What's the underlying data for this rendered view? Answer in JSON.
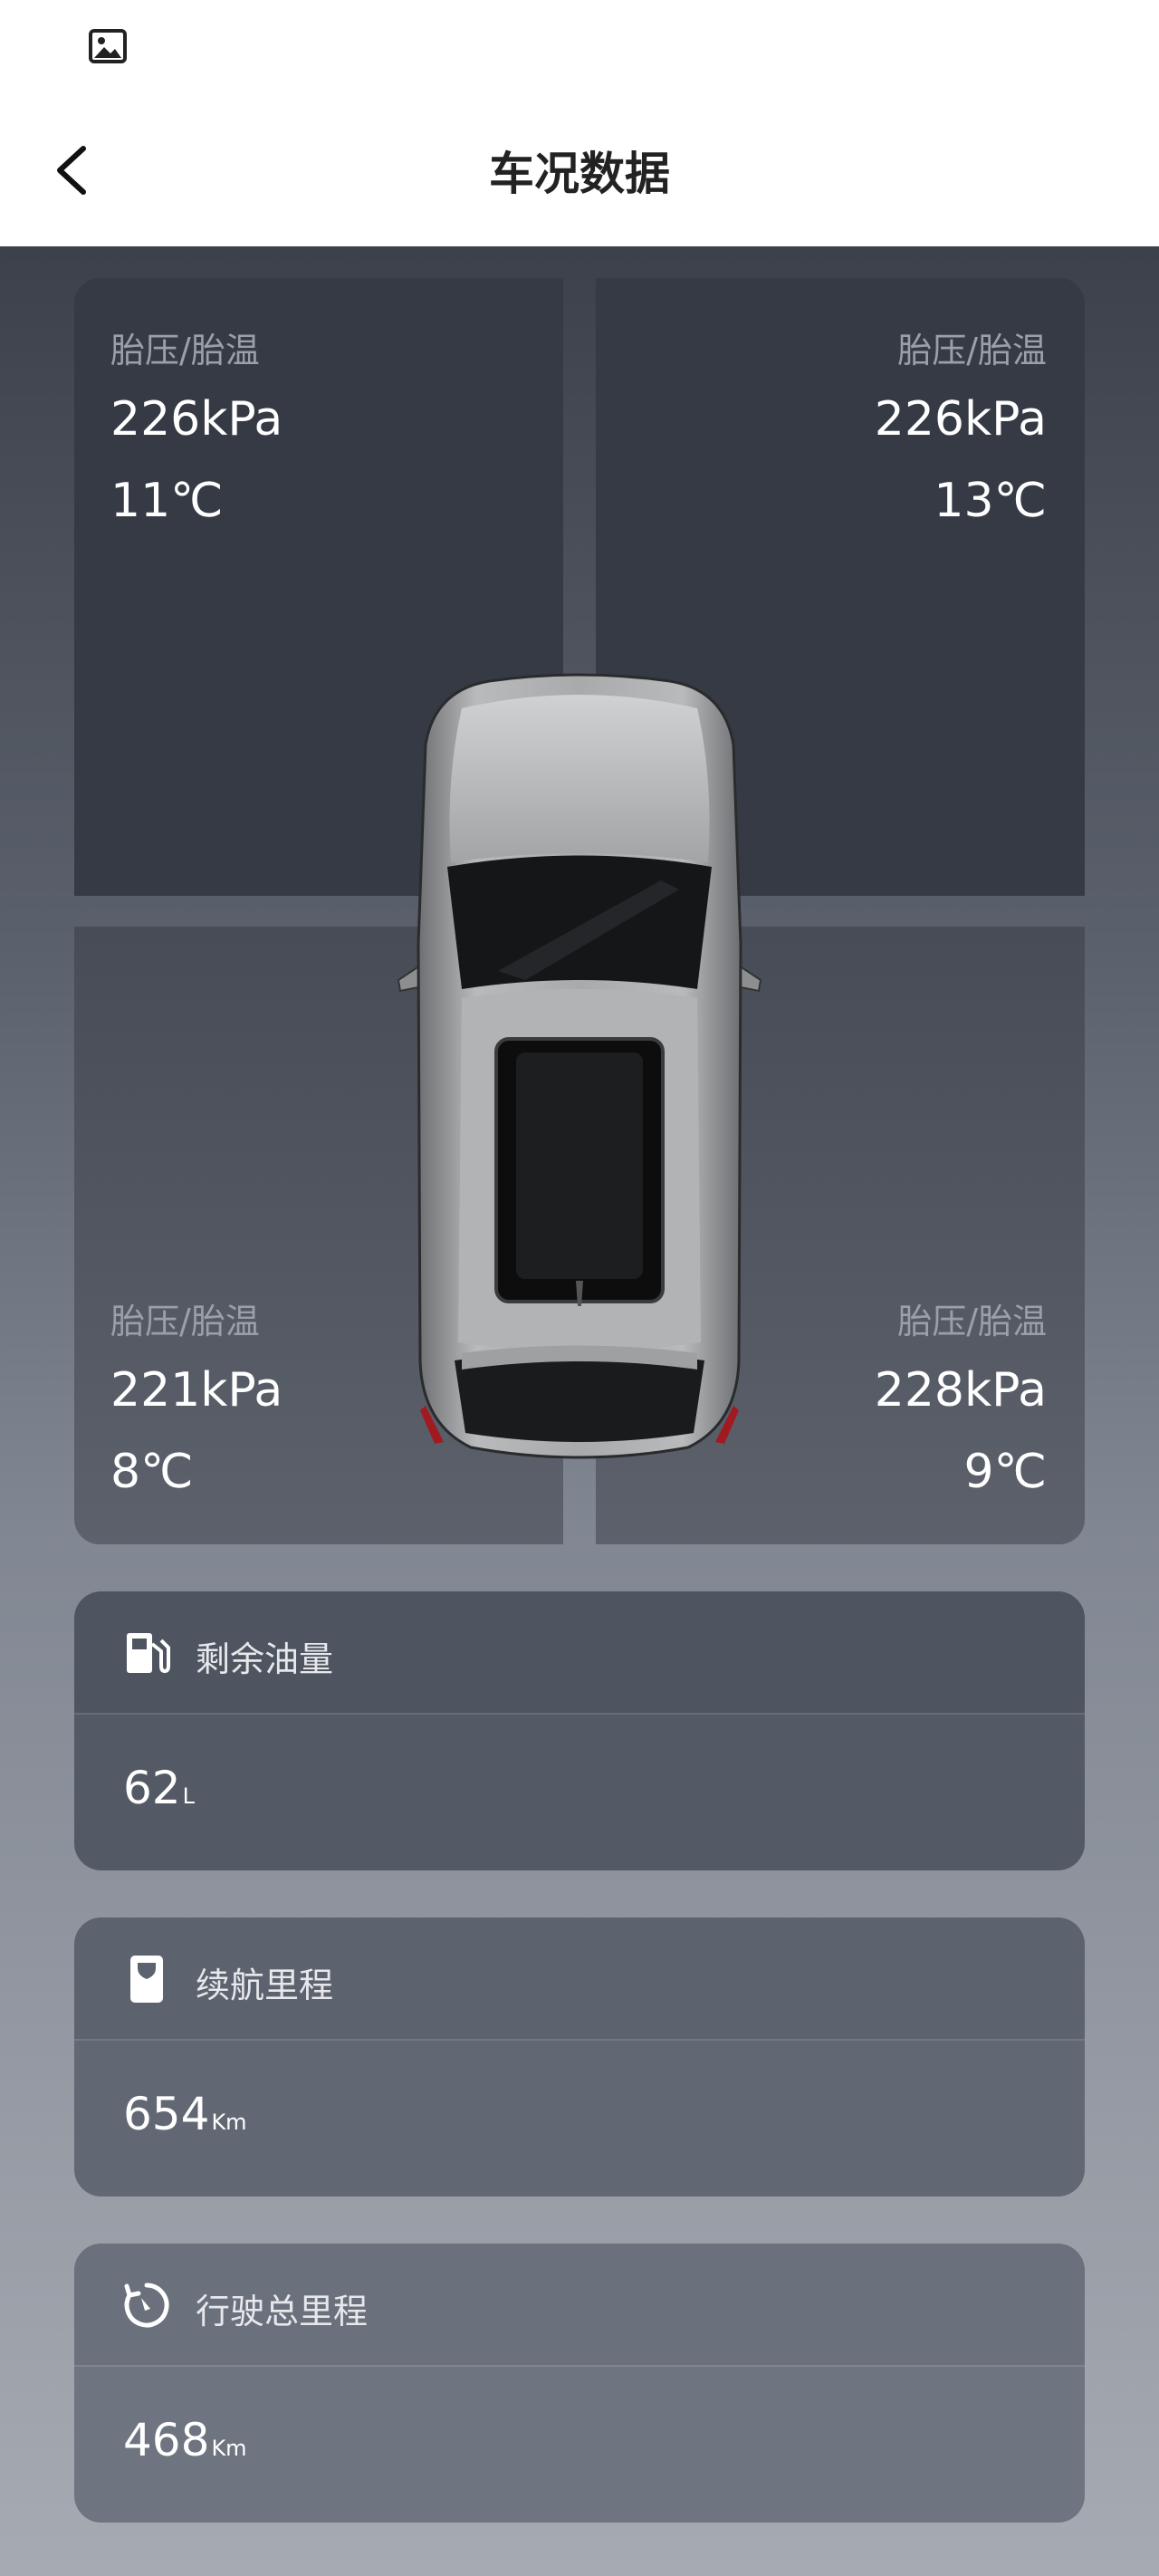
{
  "header": {
    "title": "车况数据"
  },
  "tires": {
    "front_left": {
      "label": "胎压/胎温",
      "pressure": "226kPa",
      "temp": "11℃"
    },
    "front_right": {
      "label": "胎压/胎温",
      "pressure": "226kPa",
      "temp": "13℃"
    },
    "rear_left": {
      "label": "胎压/胎温",
      "pressure": "221kPa",
      "temp": "8℃"
    },
    "rear_right": {
      "label": "胎压/胎温",
      "pressure": "228kPa",
      "temp": "9℃"
    }
  },
  "cards": {
    "fuel": {
      "title": "剩余油量",
      "value": "62",
      "unit": "L",
      "icon": "fuel-pump-icon"
    },
    "range": {
      "title": "续航里程",
      "value": "654",
      "unit": "Km",
      "icon": "hourglass-icon"
    },
    "odometer": {
      "title": "行驶总里程",
      "value": "468",
      "unit": "Km",
      "icon": "odometer-icon"
    }
  },
  "colors": {
    "accent": "#ffffff",
    "panel_dark": "#353a44",
    "label_gray": "#9aa0aa"
  }
}
